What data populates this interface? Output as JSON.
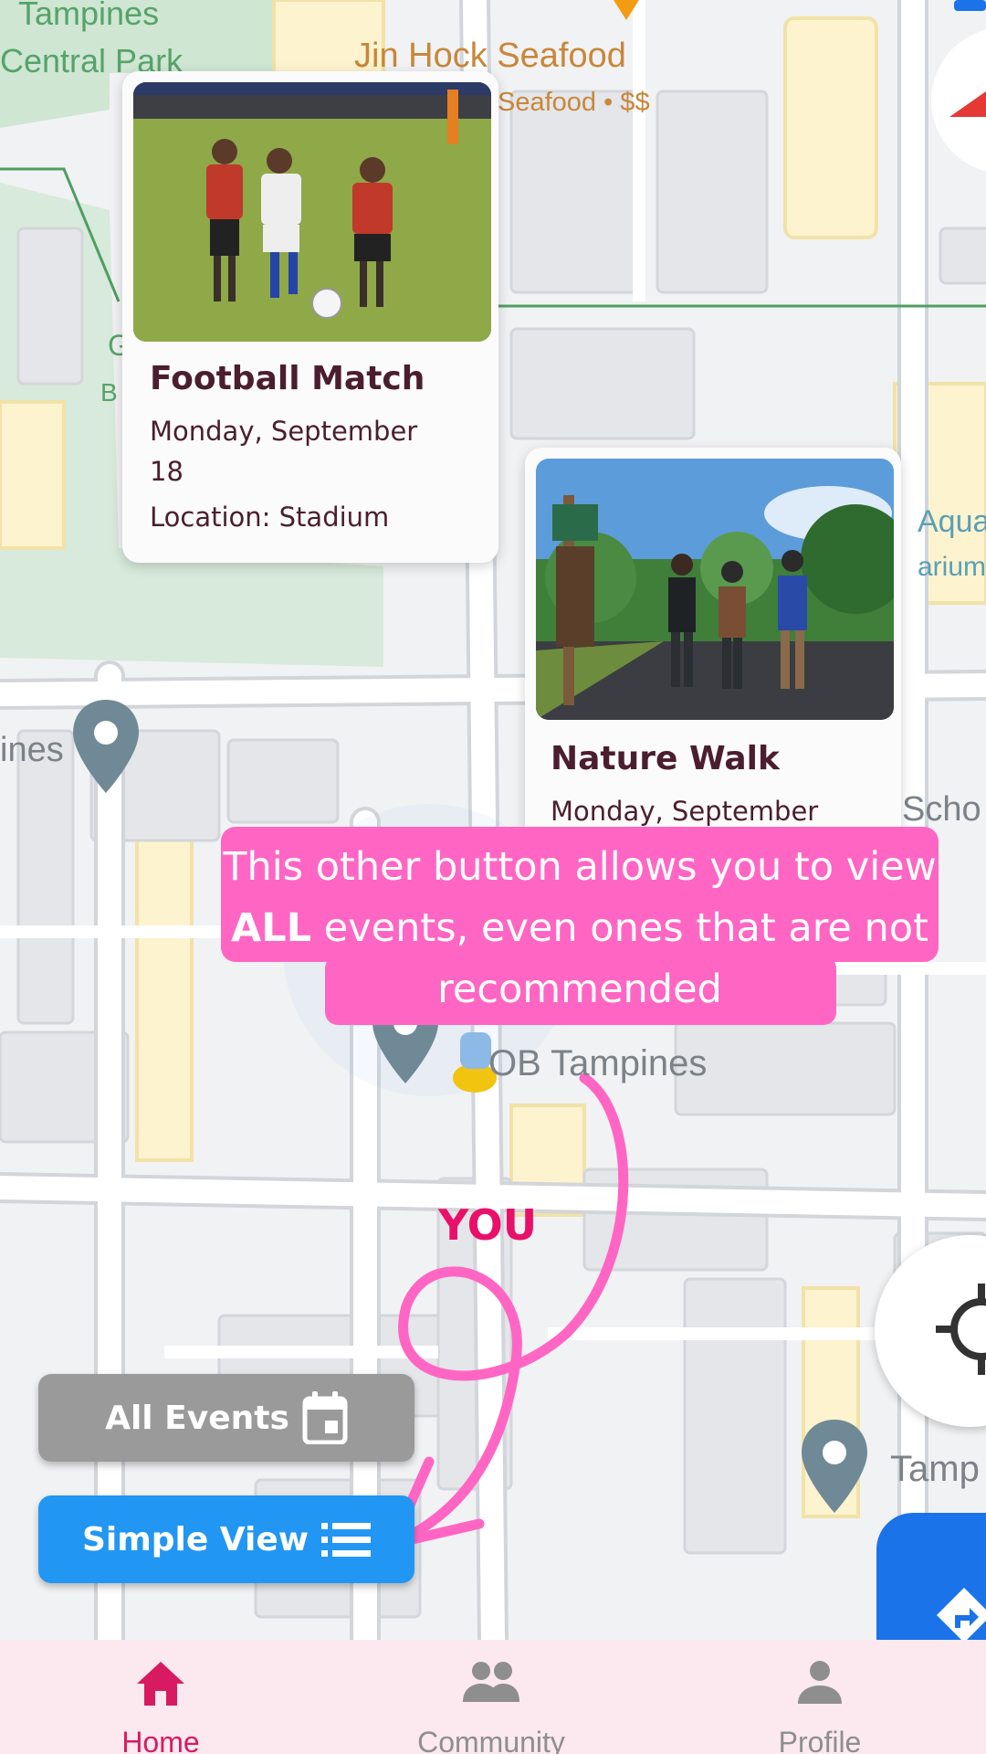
{
  "map": {
    "labels": {
      "park_line1": "Tampines",
      "park_line2": "Central Park",
      "restaurant_name": "Jin Hock Seafood",
      "restaurant_sub": "Seafood • $$",
      "aquarium_line1": "Aquar",
      "aquarium_line2": "arium",
      "left_fragment": "ines",
      "school_fragment": "Scho",
      "place_name": "OB Tampines",
      "right_fragment": "Tamp",
      "park_letter": "G",
      "park_letter2": "B"
    },
    "user_marker_label": "YOU"
  },
  "events": [
    {
      "title": "Football Match",
      "date_line1": "Monday, September",
      "date_line2": "18",
      "location": "Location: Stadium"
    },
    {
      "title": "Nature Walk",
      "date_line1": "Monday, September"
    }
  ],
  "tooltip": {
    "before_bold": "This other button allows you to view ",
    "bold": "ALL",
    "after_bold": " events, even ones that are not recommended"
  },
  "buttons": {
    "all_events": "All Events",
    "simple_view": "Simple View"
  },
  "bottom_nav": {
    "home": "Home",
    "community": "Community",
    "profile": "Profile",
    "active": "Home"
  },
  "icons": {
    "all_events": "calendar-icon",
    "simple_view": "list-icon",
    "locate": "crosshair-icon",
    "directions": "directions-icon",
    "home": "home-icon",
    "community": "people-icon",
    "profile": "person-icon"
  },
  "colors": {
    "tooltip_bg": "#ff66c4",
    "accent_pink": "#e9106a",
    "simple_view_bg": "#2196f3",
    "all_events_bg": "#9a9a9a",
    "nav_bg": "#fbe9ef",
    "nav_active": "#d81b60",
    "card_title": "#4b1e2f"
  }
}
